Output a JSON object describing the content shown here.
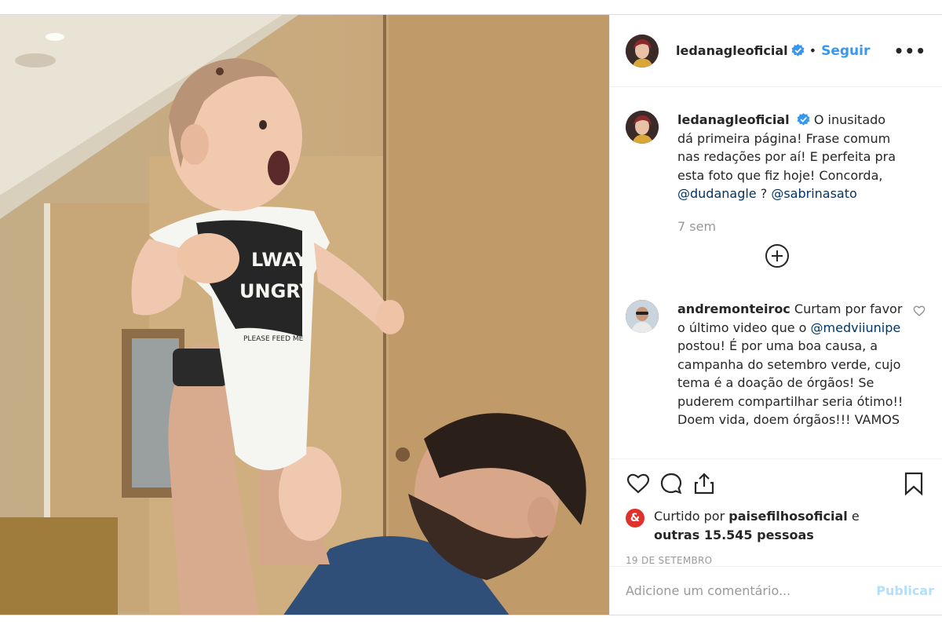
{
  "post": {
    "username": "ledanagleoficial",
    "dot": "•",
    "follow_label": "Seguir",
    "more_label": "•••",
    "caption": {
      "username": "ledanagleoficial",
      "text": "O inusitado dá primeira página! Frase comum nas redações por aí! E perfeita pra esta foto que fiz hoje! Concorda,",
      "mention1": "@dudanagle",
      "separator": " ? ",
      "mention2": "@sabrinasato",
      "time": "7 sem"
    },
    "comment": {
      "username": "andremonteiroc",
      "text1": "Curtam por favor o último video que o",
      "mention": "@medviiunipe",
      "text2": "postou! É por uma boa causa, a campanha do setembro verde, cujo tema é a doação de órgãos! Se puderem compartilhar seria ótimo!! Doem vida, doem órgãos!!! VAMOS"
    },
    "likes": {
      "badge": "&",
      "prefix": "Curtido por",
      "liker": "paisefilhosoficial",
      "connector": "e",
      "others": "outras 15.545 pessoas"
    },
    "date": "19 DE SETEMBRO",
    "add_comment": {
      "placeholder": "Adicione um comentário...",
      "publish_label": "Publicar"
    },
    "photo": {
      "shirt_line1": "LWAYS",
      "shirt_line2": "UNGRY",
      "shirt_line3": "PLEASE FEED ME"
    }
  },
  "colors": {
    "accent": "#3897f0",
    "mention": "#003569",
    "muted": "#999999",
    "publish_disabled": "#b2dffc",
    "badge": "#e0312b"
  }
}
